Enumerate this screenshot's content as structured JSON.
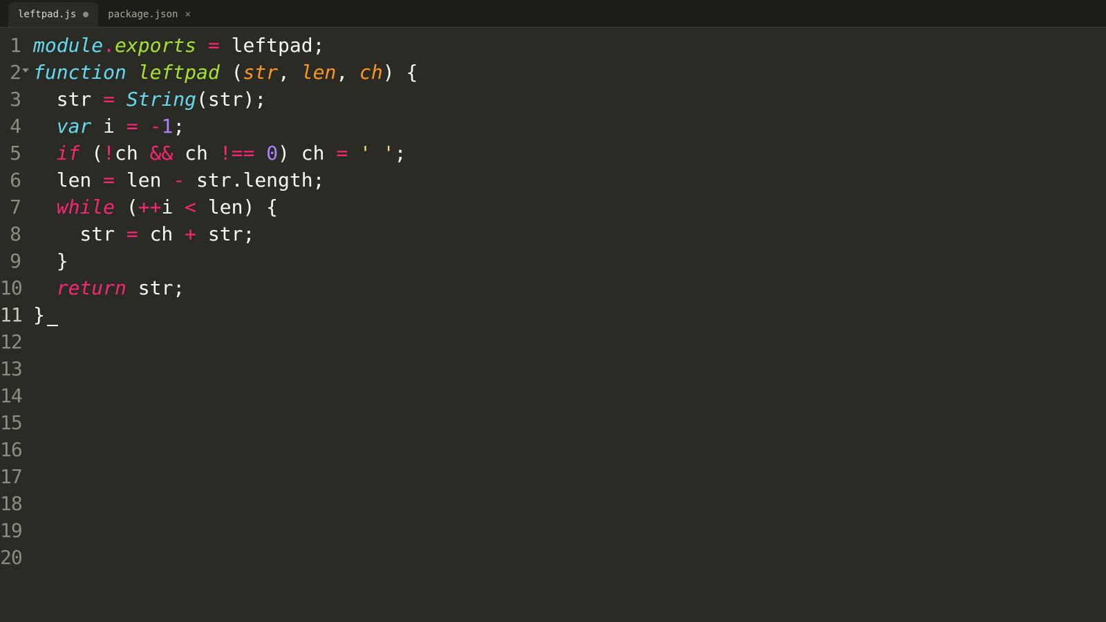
{
  "tabs": [
    {
      "label": "leftpad.js",
      "modified": true,
      "active": true
    },
    {
      "label": "package.json",
      "modified": false,
      "active": false
    }
  ],
  "filename": "leftpad.js",
  "language": "javascript",
  "line_numbers": [
    1,
    2,
    3,
    4,
    5,
    6,
    7,
    8,
    9,
    10,
    11,
    12,
    13,
    14,
    15,
    16,
    17,
    18,
    19,
    20
  ],
  "active_line": 11,
  "fold_at_line": 2,
  "code": {
    "raw": "module.exports = leftpad;\nfunction leftpad (str, len, ch) {\n  str = String(str);\n  var i = -1;\n  if (!ch && ch !== 0) ch = ' ';\n  len = len - str.length;\n  while (++i < len) {\n    str = ch + str;\n  }\n  return str;\n}",
    "lines": [
      {
        "n": 1,
        "tokens": [
          [
            "md",
            "module"
          ],
          [
            "op",
            "."
          ],
          [
            "fn",
            "exports"
          ],
          [
            "pt",
            " "
          ],
          [
            "op",
            "="
          ],
          [
            "pt",
            " leftpad"
          ],
          [
            "pt",
            ";"
          ]
        ]
      },
      {
        "n": 2,
        "tokens": [
          [
            "kw2",
            "function"
          ],
          [
            "pt",
            " "
          ],
          [
            "fn",
            "leftpad"
          ],
          [
            "pt",
            " "
          ],
          [
            "pt",
            "("
          ],
          [
            "pr",
            "str"
          ],
          [
            "pt",
            ", "
          ],
          [
            "pr",
            "len"
          ],
          [
            "pt",
            ", "
          ],
          [
            "pr",
            "ch"
          ],
          [
            "pt",
            ") "
          ],
          [
            "pt",
            "{"
          ]
        ]
      },
      {
        "n": 3,
        "tokens": [
          [
            "pt",
            "  str "
          ],
          [
            "op",
            "="
          ],
          [
            "pt",
            " "
          ],
          [
            "bi",
            "String"
          ],
          [
            "pt",
            "(str);"
          ]
        ]
      },
      {
        "n": 4,
        "tokens": [
          [
            "pt",
            "  "
          ],
          [
            "kw2",
            "var"
          ],
          [
            "pt",
            " i "
          ],
          [
            "op",
            "="
          ],
          [
            "pt",
            " "
          ],
          [
            "op",
            "-"
          ],
          [
            "nm",
            "1"
          ],
          [
            "pt",
            ";"
          ]
        ]
      },
      {
        "n": 5,
        "tokens": [
          [
            "pt",
            "  "
          ],
          [
            "kw",
            "if"
          ],
          [
            "pt",
            " ("
          ],
          [
            "op",
            "!"
          ],
          [
            "pt",
            "ch "
          ],
          [
            "op",
            "&&"
          ],
          [
            "pt",
            " ch "
          ],
          [
            "op",
            "!=="
          ],
          [
            "pt",
            " "
          ],
          [
            "nm",
            "0"
          ],
          [
            "pt",
            ") ch "
          ],
          [
            "op",
            "="
          ],
          [
            "pt",
            " "
          ],
          [
            "st",
            "' '"
          ],
          [
            "pt",
            ";"
          ]
        ]
      },
      {
        "n": 6,
        "tokens": [
          [
            "pt",
            "  len "
          ],
          [
            "op",
            "="
          ],
          [
            "pt",
            " len "
          ],
          [
            "op",
            "-"
          ],
          [
            "pt",
            " str"
          ],
          [
            "pt",
            "."
          ],
          [
            "pt",
            "length;"
          ]
        ]
      },
      {
        "n": 7,
        "tokens": [
          [
            "pt",
            "  "
          ],
          [
            "kw",
            "while"
          ],
          [
            "pt",
            " ("
          ],
          [
            "op",
            "++"
          ],
          [
            "pt",
            "i "
          ],
          [
            "op",
            "<"
          ],
          [
            "pt",
            " len) {"
          ]
        ]
      },
      {
        "n": 8,
        "tokens": [
          [
            "pt",
            "    str "
          ],
          [
            "op",
            "="
          ],
          [
            "pt",
            " ch "
          ],
          [
            "op",
            "+"
          ],
          [
            "pt",
            " str;"
          ]
        ]
      },
      {
        "n": 9,
        "tokens": [
          [
            "pt",
            "  }"
          ]
        ]
      },
      {
        "n": 10,
        "tokens": [
          [
            "pt",
            "  "
          ],
          [
            "kw",
            "return"
          ],
          [
            "pt",
            " str;"
          ]
        ]
      },
      {
        "n": 11,
        "tokens": [
          [
            "pt",
            "}"
          ]
        ]
      }
    ]
  },
  "colors": {
    "background": "#2a2b25",
    "keyword": "#f92672",
    "builtin": "#66d9ef",
    "function": "#a6e22e",
    "param": "#fd971f",
    "number": "#ae81ff",
    "string": "#e6db74",
    "plain": "#f8f8f2"
  }
}
